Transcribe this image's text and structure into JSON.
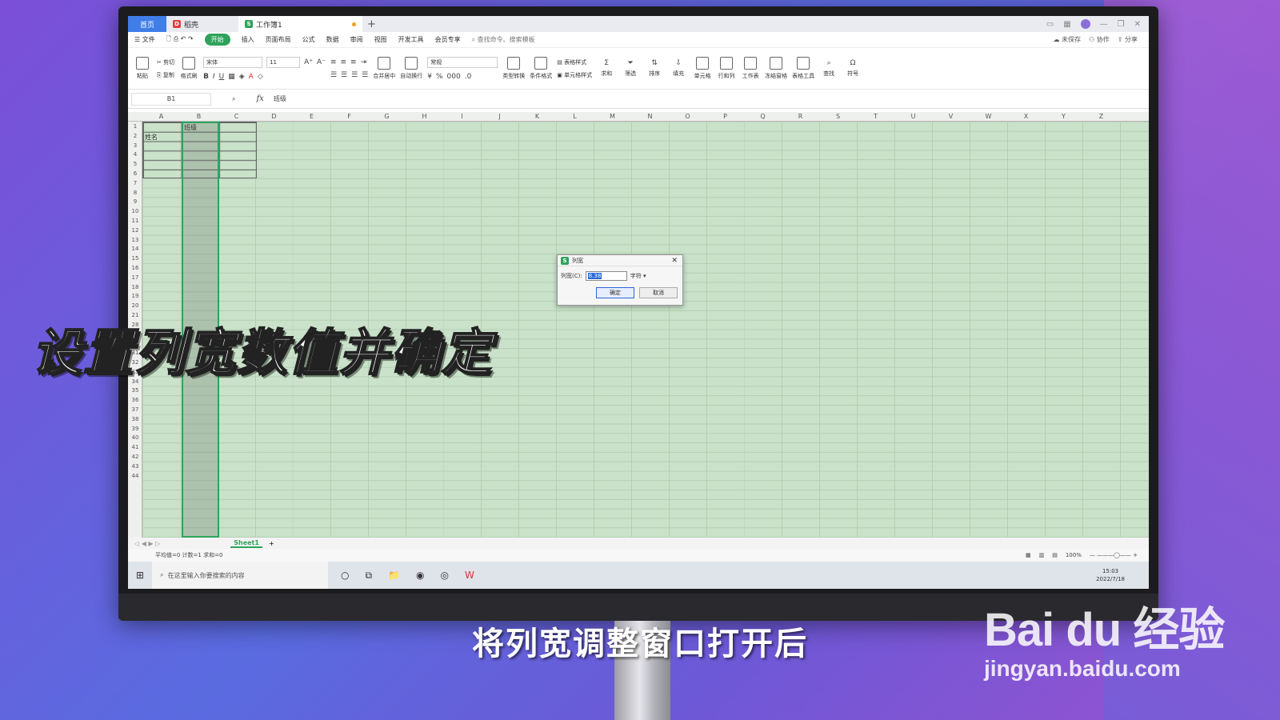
{
  "tabs": {
    "home": "首页",
    "doc": "稻壳",
    "workbook": "工作簿1"
  },
  "menu": {
    "file": "文件",
    "items": [
      "开始",
      "插入",
      "页面布局",
      "公式",
      "数据",
      "审阅",
      "视图",
      "开发工具",
      "会员专享"
    ],
    "search": "查找命令、搜索模板",
    "unsaved": "未保存",
    "collab": "协作",
    "share": "分享"
  },
  "ribbon": {
    "paste": "粘贴",
    "cut": "剪切",
    "copy": "复制",
    "format_painter": "格式刷",
    "font": "宋体",
    "size": "11",
    "number_format": "常规",
    "merge": "合并居中",
    "wrap": "自动换行",
    "convert": "类型转换",
    "cond_format": "条件格式",
    "table_style": "表格样式",
    "cell_style": "单元格样式",
    "sum": "求和",
    "filter": "筛选",
    "sort": "排序",
    "fill": "填充",
    "cell": "单元格",
    "row_col": "行和列",
    "worksheet": "工作表",
    "freeze": "冻结窗格",
    "table_tools": "表格工具",
    "find": "查找",
    "symbol": "符号"
  },
  "formula_bar": {
    "cell_ref": "B1",
    "fx": "fx",
    "content": "班级"
  },
  "grid": {
    "columns": [
      "A",
      "B",
      "C",
      "D",
      "E",
      "F",
      "G",
      "H",
      "I",
      "J",
      "K",
      "L",
      "M",
      "N",
      "O",
      "P",
      "Q",
      "R",
      "S",
      "T",
      "U",
      "V",
      "W",
      "X",
      "Y",
      "Z"
    ],
    "rows": [
      "1",
      "2",
      "3",
      "4",
      "5",
      "6",
      "7",
      "8",
      "9",
      "10",
      "11",
      "12",
      "13",
      "14",
      "15",
      "16",
      "17",
      "18",
      "19",
      "20",
      "21",
      "28",
      "29",
      "30",
      "31",
      "32",
      "33",
      "34",
      "35",
      "36",
      "37",
      "38",
      "39",
      "40",
      "41",
      "42",
      "43",
      "44"
    ],
    "cell_b1": "班级",
    "cell_a2": "姓名"
  },
  "sheet_tab": "Sheet1",
  "status": {
    "stats": "平均值=0  计数=1  求和=0",
    "zoom": "100%"
  },
  "taskbar": {
    "search": "在这里输入你要搜索的内容",
    "time": "15:03",
    "date": "2022/7/18"
  },
  "dialog": {
    "title": "列宽",
    "label": "列宽(C):",
    "value": "8.38",
    "unit": "字符",
    "ok": "确定",
    "cancel": "取消"
  },
  "overlay": {
    "caption": "设置列宽数值并确定",
    "subtitle": "将列宽调整窗口打开后"
  },
  "watermark": {
    "logo": "Bai du 经验",
    "url": "jingyan.baidu.com"
  }
}
